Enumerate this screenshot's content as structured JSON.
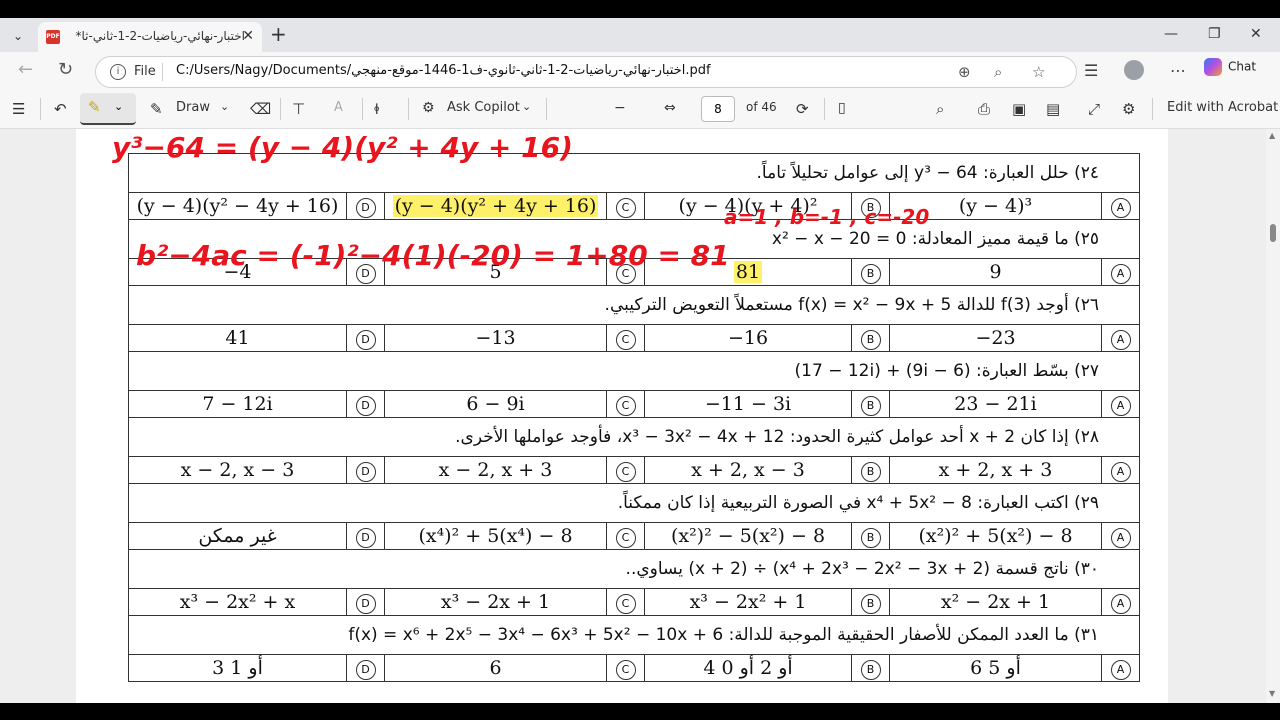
{
  "tab": {
    "title": "اختبار-نهائي-رياضيات-2-1-ثاني-ثا*",
    "pdf_badge": "PDF"
  },
  "address": {
    "file_label": "File",
    "url": "C:/Users/Nagy/Documents/اختبار-نهائي-رياضيات-2-1-ثاني-ثانوي-ف1-1446-موقع-منهجي.pdf"
  },
  "chat_label": "Chat",
  "toolbar": {
    "draw": "Draw",
    "ask_copilot": "Ask Copilot",
    "page_current": "8",
    "page_total": "of 46",
    "edit_acrobat": "Edit with Acrobat",
    "read_aloud": "ꬹ"
  },
  "questions": [
    {
      "num": "٢٤) حلل العبارة: 64 − y³ إلى عوامل تحليلاً تاماً.",
      "options": [
        {
          "letter": "A",
          "text": "(y − 4)³"
        },
        {
          "letter": "B",
          "text": "(y − 4)(y + 4)²"
        },
        {
          "letter": "C",
          "text": "(y − 4)(y² + 4y + 16)"
        },
        {
          "letter": "D",
          "text": "(y − 4)(y² − 4y + 16)"
        }
      ]
    },
    {
      "num": "٢٥) ما قيمة مميز المعادلة: x² − x − 20 = 0",
      "options": [
        {
          "letter": "A",
          "text": "9"
        },
        {
          "letter": "B",
          "text": "81"
        },
        {
          "letter": "C",
          "text": "5"
        },
        {
          "letter": "D",
          "text": "−4"
        }
      ]
    },
    {
      "num": "٢٦) أوجد f(3) للدالة f(x) = x² − 9x + 5 مستعملاً التعويض التركيبي.",
      "options": [
        {
          "letter": "A",
          "text": "−23"
        },
        {
          "letter": "B",
          "text": "−16"
        },
        {
          "letter": "C",
          "text": "−13"
        },
        {
          "letter": "D",
          "text": "41"
        }
      ]
    },
    {
      "num": "٢٧) بسّط العبارة: (6 − 9i) + (17 − 12i)",
      "options": [
        {
          "letter": "A",
          "text": "23 − 21i"
        },
        {
          "letter": "B",
          "text": "−11 − 3i"
        },
        {
          "letter": "C",
          "text": "6 − 9i"
        },
        {
          "letter": "D",
          "text": "7 − 12i"
        }
      ]
    },
    {
      "num": "٢٨) إذا كان x + 2 أحد عوامل كثيرة الحدود: x³ − 3x² − 4x + 12، فأوجد عواملها الأخرى.",
      "options": [
        {
          "letter": "A",
          "text": "x + 2, x + 3"
        },
        {
          "letter": "B",
          "text": "x + 2, x − 3"
        },
        {
          "letter": "C",
          "text": "x − 2, x + 3"
        },
        {
          "letter": "D",
          "text": "x − 2, x − 3"
        }
      ]
    },
    {
      "num": "٢٩) اكتب العبارة: x⁴ + 5x² − 8 في الصورة التربيعية إذا كان ممكناً.",
      "options": [
        {
          "letter": "A",
          "text": "(x²)² + 5(x²) − 8"
        },
        {
          "letter": "B",
          "text": "(x²)² − 5(x²) − 8"
        },
        {
          "letter": "C",
          "text": "(x⁴)² + 5(x⁴) − 8"
        },
        {
          "letter": "D",
          "text": "غير ممكن"
        }
      ]
    },
    {
      "num": "٣٠) ناتج قسمة (x⁴ + 2x³ − 2x² − 3x + 2) ÷ (x + 2) يساوي..",
      "options": [
        {
          "letter": "A",
          "text": "x² − 2x + 1"
        },
        {
          "letter": "B",
          "text": "x³ − 2x² + 1"
        },
        {
          "letter": "C",
          "text": "x³ − 2x + 1"
        },
        {
          "letter": "D",
          "text": "x³ − 2x² + x"
        }
      ]
    },
    {
      "num": "٣١) ما العدد الممكن للأصفار الحقيقية الموجبة للدالة: f(x) = x⁶ + 2x⁵ − 3x⁴ − 6x³ + 5x² − 10x + 6",
      "options": [
        {
          "letter": "A",
          "text": "6 أو 5"
        },
        {
          "letter": "B",
          "text": "4 أو 2 أو 0"
        },
        {
          "letter": "C",
          "text": "6"
        },
        {
          "letter": "D",
          "text": "3 أو 1"
        }
      ]
    }
  ],
  "highlighted": [
    "(y − 4)(y² + 4y + 16)",
    "81"
  ],
  "annotations": {
    "line1": "y³−64 = (y − 4)(y² + 4y + 16)",
    "line2": "a=1 , b=-1 , c=-20",
    "line3": "b²−4ac = (-1)²−4(1)(-20) = 1+80 = 81"
  },
  "colors": {
    "ink": "#e8141e",
    "highlight": "#fff06a"
  }
}
